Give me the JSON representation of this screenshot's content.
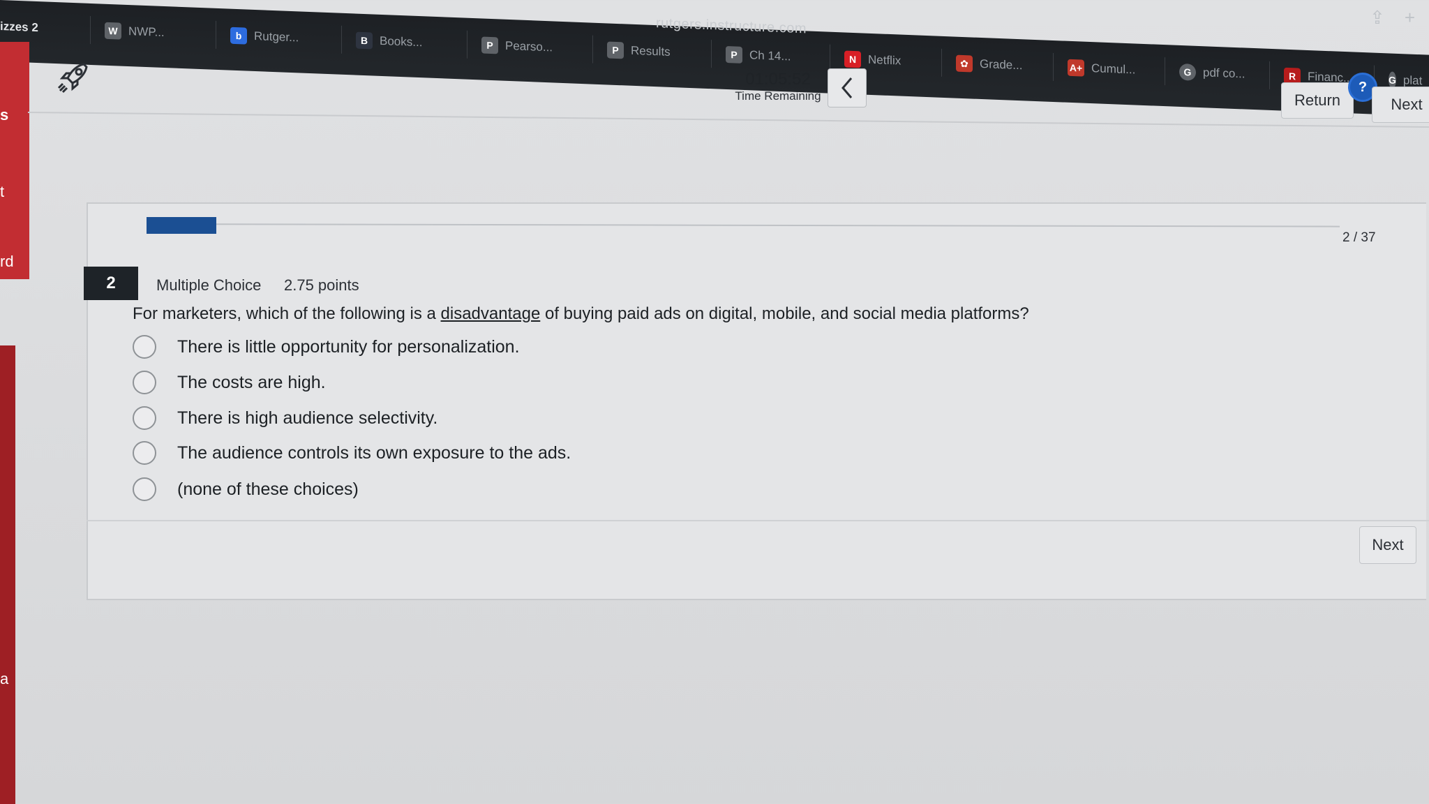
{
  "browser": {
    "url_fragment": "rutgers.instructure.com",
    "tabs": [
      {
        "label": "izzes 2",
        "icon": "",
        "color": ""
      },
      {
        "label": "NWP...",
        "icon": "W",
        "color": "#5f6368"
      },
      {
        "label": "Rutger...",
        "icon": "b",
        "color": "#2d6cdf"
      },
      {
        "label": "Books...",
        "icon": "B",
        "color": "#2e3440"
      },
      {
        "label": "Pearso...",
        "icon": "P",
        "color": "#5f6368"
      },
      {
        "label": "Results",
        "icon": "P",
        "color": "#5f6368"
      },
      {
        "label": "Ch 14...",
        "icon": "P",
        "color": "#5f6368"
      },
      {
        "label": "Netflix",
        "icon": "N",
        "color": "#d81f26"
      },
      {
        "label": "Grade...",
        "icon": "✿",
        "color": "#c0392b"
      },
      {
        "label": "Cumul...",
        "icon": "A+",
        "color": "#c0392b"
      },
      {
        "label": "pdf co...",
        "icon": "G",
        "color": "#5f6368"
      },
      {
        "label": "Financ...",
        "icon": "R",
        "color": "#b71c1c"
      },
      {
        "label": "plat",
        "icon": "G",
        "color": "#5f6368"
      }
    ]
  },
  "sidebar": {
    "labels": [
      "s",
      "t",
      "rd",
      "a"
    ]
  },
  "header": {
    "time": "01:05:52",
    "time_label": "Time Remaining",
    "return_label": "Return",
    "next_label": "Next",
    "help_label": "?"
  },
  "progress": {
    "current": 2,
    "total": 37,
    "count_text": "2 / 37"
  },
  "question": {
    "number": "2",
    "type": "Multiple Choice",
    "points": "2.75 points",
    "text_before": "For marketers, which of the following is a ",
    "text_underlined": "disadvantage",
    "text_after": " of buying paid ads on digital, mobile, and social media platforms?",
    "options": [
      "There is little opportunity for personalization.",
      "The costs are high.",
      "There is high audience selectivity.",
      "The audience controls its own exposure to the ads.",
      "(none of these choices)"
    ]
  },
  "footer": {
    "next_label": "Next"
  }
}
